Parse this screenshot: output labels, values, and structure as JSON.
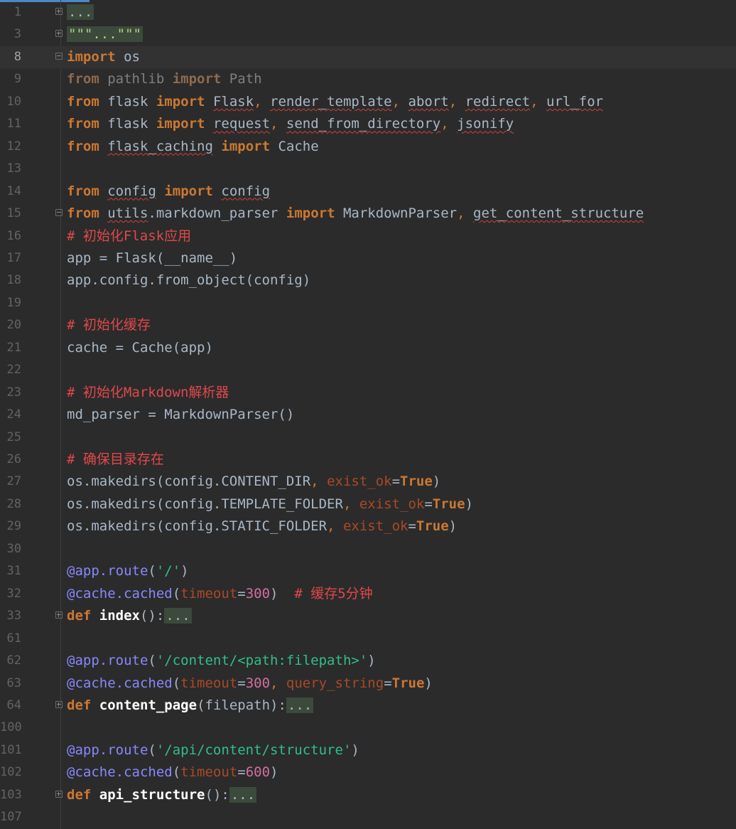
{
  "editor": {
    "lines": [
      {
        "n": "1",
        "tokens": [
          {
            "t": "...",
            "c": "fold-text"
          }
        ],
        "fold": "plus"
      },
      {
        "n": "3",
        "tokens": [
          {
            "t": "\"\"\"...\"\"\"",
            "c": "fold-text str"
          }
        ],
        "fold": "plus"
      },
      {
        "n": "8",
        "current": true,
        "tokens": [
          {
            "t": "import",
            "c": "kw"
          },
          {
            "t": " os",
            "c": "mod"
          }
        ],
        "fold": "minus"
      },
      {
        "n": "9",
        "tokens": [
          {
            "t": "from",
            "c": "dimkw"
          },
          {
            "t": " pathlib ",
            "c": "dim"
          },
          {
            "t": "import",
            "c": "dimkw"
          },
          {
            "t": " Path",
            "c": "dim"
          }
        ]
      },
      {
        "n": "10",
        "tokens": [
          {
            "t": "from",
            "c": "kw"
          },
          {
            "t": " flask ",
            "c": "mod"
          },
          {
            "t": "import",
            "c": "kw"
          },
          {
            "t": " ",
            "c": "mod"
          },
          {
            "t": "Flask",
            "c": "mod squiggle"
          },
          {
            "t": ", ",
            "c": "punct"
          },
          {
            "t": "render_template",
            "c": "mod squiggle"
          },
          {
            "t": ", ",
            "c": "punct"
          },
          {
            "t": "abort",
            "c": "mod squiggle"
          },
          {
            "t": ", ",
            "c": "punct"
          },
          {
            "t": "redirect",
            "c": "mod squiggle"
          },
          {
            "t": ", ",
            "c": "punct"
          },
          {
            "t": "url_for",
            "c": "mod squiggle"
          }
        ]
      },
      {
        "n": "11",
        "tokens": [
          {
            "t": "from",
            "c": "kw"
          },
          {
            "t": " flask ",
            "c": "mod"
          },
          {
            "t": "import",
            "c": "kw"
          },
          {
            "t": " ",
            "c": "mod"
          },
          {
            "t": "request",
            "c": "mod squiggle"
          },
          {
            "t": ", ",
            "c": "punct"
          },
          {
            "t": "send_from_directory",
            "c": "mod squiggle"
          },
          {
            "t": ", ",
            "c": "punct"
          },
          {
            "t": "jsonify",
            "c": "mod squiggle"
          }
        ]
      },
      {
        "n": "12",
        "tokens": [
          {
            "t": "from",
            "c": "kw"
          },
          {
            "t": " ",
            "c": "mod"
          },
          {
            "t": "flask_caching",
            "c": "mod squiggle"
          },
          {
            "t": " ",
            "c": "mod"
          },
          {
            "t": "import",
            "c": "kw"
          },
          {
            "t": " Cache",
            "c": "mod"
          }
        ]
      },
      {
        "n": "13",
        "tokens": []
      },
      {
        "n": "14",
        "tokens": [
          {
            "t": "from",
            "c": "kw"
          },
          {
            "t": " ",
            "c": "mod"
          },
          {
            "t": "config",
            "c": "mod squiggle"
          },
          {
            "t": " ",
            "c": "mod"
          },
          {
            "t": "import",
            "c": "kw"
          },
          {
            "t": " ",
            "c": "mod"
          },
          {
            "t": "config",
            "c": "mod squiggle"
          }
        ]
      },
      {
        "n": "15",
        "fold": "minus",
        "tokens": [
          {
            "t": "from",
            "c": "kw"
          },
          {
            "t": " ",
            "c": "mod"
          },
          {
            "t": "utils",
            "c": "mod squiggle"
          },
          {
            "t": ".markdown_parser ",
            "c": "mod"
          },
          {
            "t": "import",
            "c": "kw"
          },
          {
            "t": " MarkdownParser",
            "c": "mod"
          },
          {
            "t": ", ",
            "c": "punct"
          },
          {
            "t": "get_content_structure",
            "c": "mod squiggle"
          }
        ]
      },
      {
        "n": "16",
        "tokens": [
          {
            "t": "# 初始化Flask应用",
            "c": "cmt"
          }
        ]
      },
      {
        "n": "17",
        "tokens": [
          {
            "t": "app = Flask(__name__)",
            "c": "mod"
          }
        ]
      },
      {
        "n": "18",
        "tokens": [
          {
            "t": "app.config.from_object(config)",
            "c": "mod"
          }
        ]
      },
      {
        "n": "19",
        "tokens": []
      },
      {
        "n": "20",
        "tokens": [
          {
            "t": "# 初始化缓存",
            "c": "cmt"
          }
        ]
      },
      {
        "n": "21",
        "tokens": [
          {
            "t": "cache = Cache(app)",
            "c": "mod"
          }
        ]
      },
      {
        "n": "22",
        "tokens": []
      },
      {
        "n": "23",
        "tokens": [
          {
            "t": "# 初始化Markdown解析器",
            "c": "cmt"
          }
        ]
      },
      {
        "n": "24",
        "tokens": [
          {
            "t": "md_parser = MarkdownParser()",
            "c": "mod"
          }
        ]
      },
      {
        "n": "25",
        "tokens": []
      },
      {
        "n": "26",
        "tokens": [
          {
            "t": "# 确保目录存在",
            "c": "cmt"
          }
        ]
      },
      {
        "n": "27",
        "tokens": [
          {
            "t": "os.makedirs(config.CONTENT_DIR",
            "c": "mod"
          },
          {
            "t": ", ",
            "c": "punct"
          },
          {
            "t": "exist_ok",
            "c": "param"
          },
          {
            "t": "=",
            "c": "mod"
          },
          {
            "t": "True",
            "c": "true"
          },
          {
            "t": ")",
            "c": "mod"
          }
        ]
      },
      {
        "n": "28",
        "tokens": [
          {
            "t": "os.makedirs(config.TEMPLATE_FOLDER",
            "c": "mod"
          },
          {
            "t": ", ",
            "c": "punct"
          },
          {
            "t": "exist_ok",
            "c": "param"
          },
          {
            "t": "=",
            "c": "mod"
          },
          {
            "t": "True",
            "c": "true"
          },
          {
            "t": ")",
            "c": "mod"
          }
        ]
      },
      {
        "n": "29",
        "tokens": [
          {
            "t": "os.makedirs(config.STATIC_FOLDER",
            "c": "mod"
          },
          {
            "t": ", ",
            "c": "punct"
          },
          {
            "t": "exist_ok",
            "c": "param"
          },
          {
            "t": "=",
            "c": "mod"
          },
          {
            "t": "True",
            "c": "true"
          },
          {
            "t": ")",
            "c": "mod"
          }
        ]
      },
      {
        "n": "30",
        "tokens": []
      },
      {
        "n": "31",
        "tokens": [
          {
            "t": "@app.route",
            "c": "deco"
          },
          {
            "t": "(",
            "c": "mod"
          },
          {
            "t": "'/'",
            "c": "str2"
          },
          {
            "t": ")",
            "c": "mod"
          }
        ]
      },
      {
        "n": "32",
        "tokens": [
          {
            "t": "@cache.cached",
            "c": "deco"
          },
          {
            "t": "(",
            "c": "mod"
          },
          {
            "t": "timeout",
            "c": "param"
          },
          {
            "t": "=",
            "c": "mod"
          },
          {
            "t": "300",
            "c": "num"
          },
          {
            "t": ")  ",
            "c": "mod"
          },
          {
            "t": "# 缓存5分钟",
            "c": "cmt"
          }
        ]
      },
      {
        "n": "33",
        "fold": "plus",
        "tokens": [
          {
            "t": "def",
            "c": "kw"
          },
          {
            "t": " ",
            "c": "mod"
          },
          {
            "t": "index",
            "c": "fn"
          },
          {
            "t": "():",
            "c": "mod"
          },
          {
            "t": "...",
            "c": "fold-text"
          }
        ]
      },
      {
        "n": "61",
        "tokens": []
      },
      {
        "n": "62",
        "tokens": [
          {
            "t": "@app.route",
            "c": "deco"
          },
          {
            "t": "(",
            "c": "mod"
          },
          {
            "t": "'/content/<path:filepath>'",
            "c": "str2"
          },
          {
            "t": ")",
            "c": "mod"
          }
        ]
      },
      {
        "n": "63",
        "tokens": [
          {
            "t": "@cache.cached",
            "c": "deco"
          },
          {
            "t": "(",
            "c": "mod"
          },
          {
            "t": "timeout",
            "c": "param"
          },
          {
            "t": "=",
            "c": "mod"
          },
          {
            "t": "300",
            "c": "num"
          },
          {
            "t": ", ",
            "c": "punct"
          },
          {
            "t": "query_string",
            "c": "param"
          },
          {
            "t": "=",
            "c": "mod"
          },
          {
            "t": "True",
            "c": "true"
          },
          {
            "t": ")",
            "c": "mod"
          }
        ]
      },
      {
        "n": "64",
        "fold": "plus",
        "tokens": [
          {
            "t": "def",
            "c": "kw"
          },
          {
            "t": " ",
            "c": "mod"
          },
          {
            "t": "content_page",
            "c": "fn"
          },
          {
            "t": "(filepath):",
            "c": "mod"
          },
          {
            "t": "...",
            "c": "fold-text"
          }
        ]
      },
      {
        "n": "100",
        "tokens": []
      },
      {
        "n": "101",
        "tokens": [
          {
            "t": "@app.route",
            "c": "deco"
          },
          {
            "t": "(",
            "c": "mod"
          },
          {
            "t": "'/api/content/structure'",
            "c": "str2"
          },
          {
            "t": ")",
            "c": "mod"
          }
        ]
      },
      {
        "n": "102",
        "tokens": [
          {
            "t": "@cache.cached",
            "c": "deco"
          },
          {
            "t": "(",
            "c": "mod"
          },
          {
            "t": "timeout",
            "c": "param"
          },
          {
            "t": "=",
            "c": "mod"
          },
          {
            "t": "600",
            "c": "num"
          },
          {
            "t": ")",
            "c": "mod"
          }
        ]
      },
      {
        "n": "103",
        "fold": "plus",
        "tokens": [
          {
            "t": "def",
            "c": "kw"
          },
          {
            "t": " ",
            "c": "mod"
          },
          {
            "t": "api_structure",
            "c": "fn"
          },
          {
            "t": "():",
            "c": "mod"
          },
          {
            "t": "...",
            "c": "fold-text"
          }
        ]
      },
      {
        "n": "107",
        "tokens": []
      }
    ]
  }
}
